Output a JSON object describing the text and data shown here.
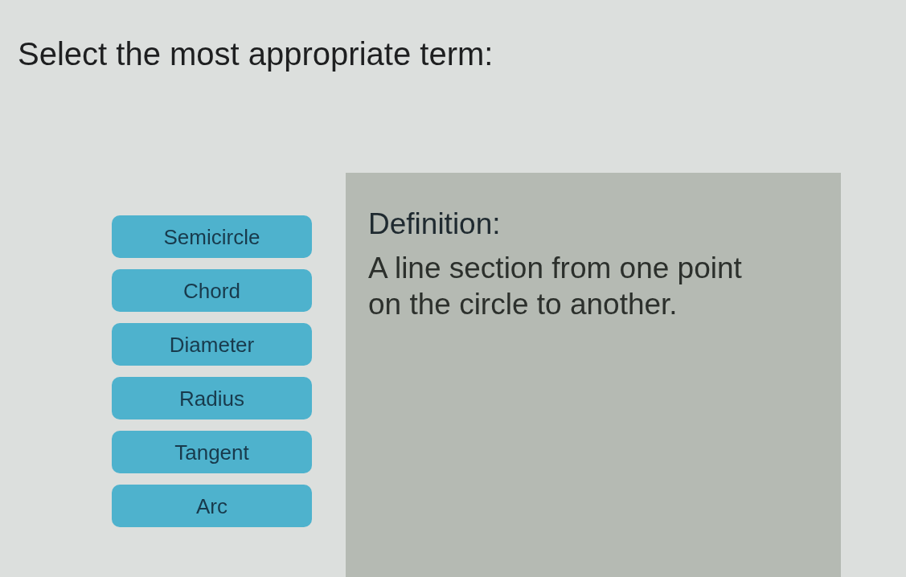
{
  "prompt": "Select the most appropriate term:",
  "terms": [
    {
      "label": "Semicircle"
    },
    {
      "label": "Chord"
    },
    {
      "label": "Diameter"
    },
    {
      "label": "Radius"
    },
    {
      "label": "Tangent"
    },
    {
      "label": "Arc"
    }
  ],
  "definition": {
    "heading": "Definition:",
    "text": "A line section from one point on the circle to another."
  }
}
